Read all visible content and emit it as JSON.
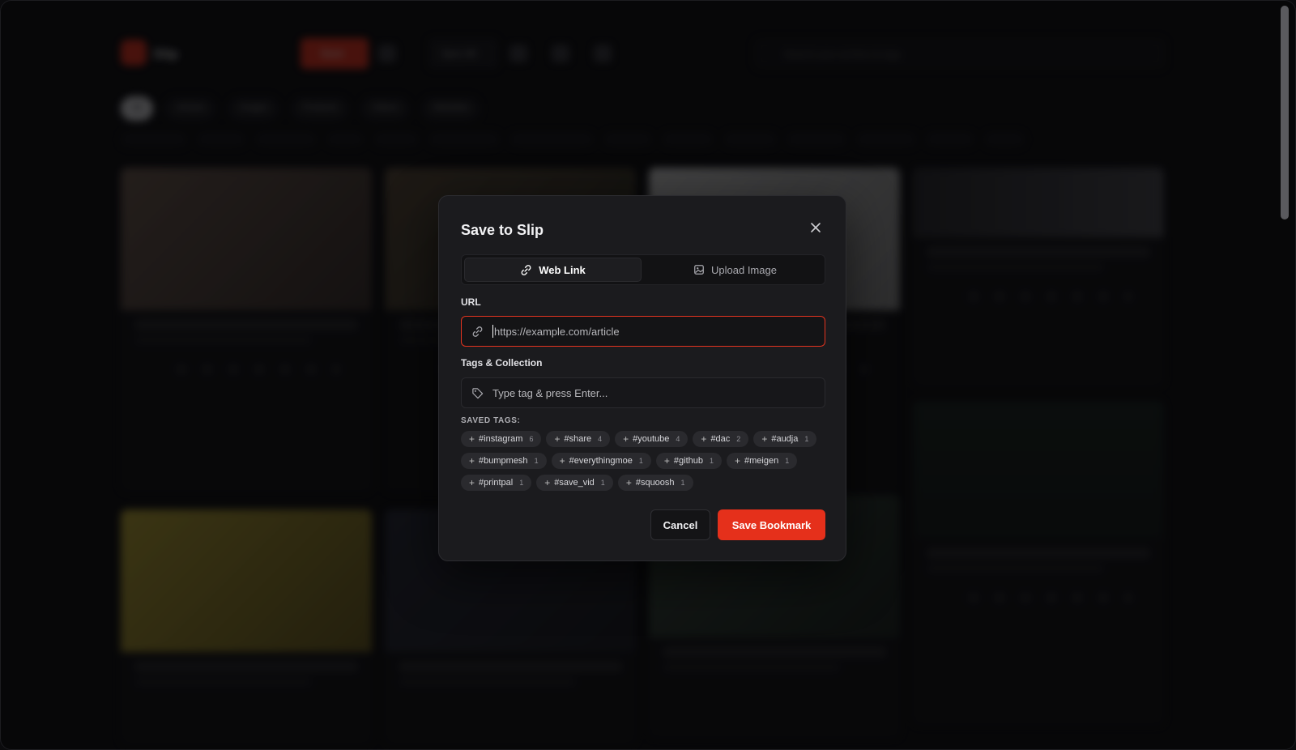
{
  "app": {
    "name": "Slip",
    "save_label": "Save",
    "sync_label": "Sync All",
    "search_placeholder": "Search your archive & tags"
  },
  "filters": [
    "All",
    "Articles",
    "Images",
    "Products",
    "Videos",
    "Websites"
  ],
  "modal": {
    "title": "Save to Slip",
    "tabs": [
      {
        "label": "Web Link",
        "icon": "link-icon",
        "active": true
      },
      {
        "label": "Upload Image",
        "icon": "image-icon",
        "active": false
      }
    ],
    "url_label": "URL",
    "url_placeholder": "https://example.com/article",
    "tags_label": "Tags & Collection",
    "tags_placeholder": "Type tag & press Enter...",
    "saved_tags_label": "SAVED TAGS:",
    "saved_tags": [
      {
        "name": "#instagram",
        "count": "6"
      },
      {
        "name": "#share",
        "count": "4"
      },
      {
        "name": "#youtube",
        "count": "4"
      },
      {
        "name": "#dac",
        "count": "2"
      },
      {
        "name": "#audja",
        "count": "1"
      },
      {
        "name": "#bumpmesh",
        "count": "1"
      },
      {
        "name": "#everythingmoe",
        "count": "1"
      },
      {
        "name": "#github",
        "count": "1"
      },
      {
        "name": "#meigen",
        "count": "1"
      },
      {
        "name": "#printpal",
        "count": "1"
      },
      {
        "name": "#save_vid",
        "count": "1"
      },
      {
        "name": "#squoosh",
        "count": "1"
      }
    ],
    "cancel_label": "Cancel",
    "save_label": "Save Bookmark"
  },
  "colors": {
    "accent": "#e5301b",
    "modal_bg": "#1b1b1e",
    "backdrop": "#0b0b0d"
  }
}
